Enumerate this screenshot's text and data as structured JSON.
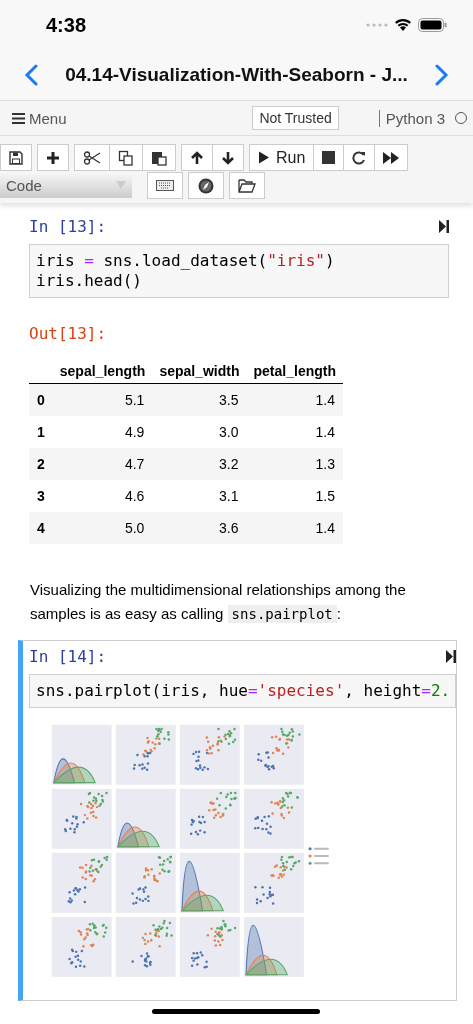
{
  "status_bar": {
    "time": "4:38"
  },
  "nav": {
    "title": "04.14-Visualization-With-Seaborn - J..."
  },
  "menubar": {
    "menu": "Menu",
    "trust": "Not Trusted",
    "kernel": "Python 3",
    "kernel_busy": false
  },
  "toolbar": {
    "groups": [
      [
        {
          "kind": "save"
        }
      ],
      [
        {
          "kind": "add"
        }
      ],
      [
        {
          "kind": "cut"
        },
        {
          "kind": "copy"
        },
        {
          "kind": "paste"
        }
      ],
      [
        {
          "kind": "up"
        },
        {
          "kind": "down"
        }
      ],
      [
        {
          "kind": "run",
          "label": "Run"
        },
        {
          "kind": "stop"
        },
        {
          "kind": "restart"
        },
        {
          "kind": "fastforward"
        }
      ]
    ],
    "cell_type": "Code",
    "extra": [
      {
        "kind": "keyboard"
      },
      {
        "kind": "compass"
      },
      {
        "kind": "folder"
      }
    ]
  },
  "cells": [
    {
      "kind": "code",
      "prompt": "In [13]:",
      "selected": false,
      "lines": [
        [
          {
            "kind": "plain",
            "text": "iris "
          },
          {
            "kind": "op",
            "text": "="
          },
          {
            "kind": "plain",
            "text": " sns.load_dataset("
          },
          {
            "kind": "string",
            "text": "\"iris\""
          },
          {
            "kind": "plain",
            "text": ")"
          }
        ],
        [
          {
            "kind": "plain",
            "text": "iris.head()"
          }
        ]
      ],
      "output": {
        "prompt": "Out[13]:",
        "table": {
          "columns": [
            "sepal_length",
            "sepal_width",
            "petal_length"
          ],
          "rows": [
            {
              "index": "0",
              "cells": [
                "5.1",
                "3.5",
                "1.4"
              ]
            },
            {
              "index": "1",
              "cells": [
                "4.9",
                "3.0",
                "1.4"
              ]
            },
            {
              "index": "2",
              "cells": [
                "4.7",
                "3.2",
                "1.3"
              ]
            },
            {
              "index": "3",
              "cells": [
                "4.6",
                "3.1",
                "1.5"
              ]
            },
            {
              "index": "4",
              "cells": [
                "5.0",
                "3.6",
                "1.4"
              ]
            }
          ]
        }
      }
    },
    {
      "kind": "markdown",
      "text": "Visualizing the multidimensional relationships among the samples is as easy as calling",
      "code": "sns.pairplot",
      "after": ":"
    },
    {
      "kind": "code",
      "prompt": "In [14]:",
      "selected": true,
      "lines": [
        [
          {
            "kind": "plain",
            "text": "sns.pairplot(iris, hue"
          },
          {
            "kind": "op",
            "text": "="
          },
          {
            "kind": "string",
            "text": "'species'"
          },
          {
            "kind": "plain",
            "text": ", height"
          },
          {
            "kind": "op",
            "text": "="
          },
          {
            "kind": "number",
            "text": "2."
          }
        ]
      ],
      "output": {
        "kind": "picture"
      }
    }
  ]
}
